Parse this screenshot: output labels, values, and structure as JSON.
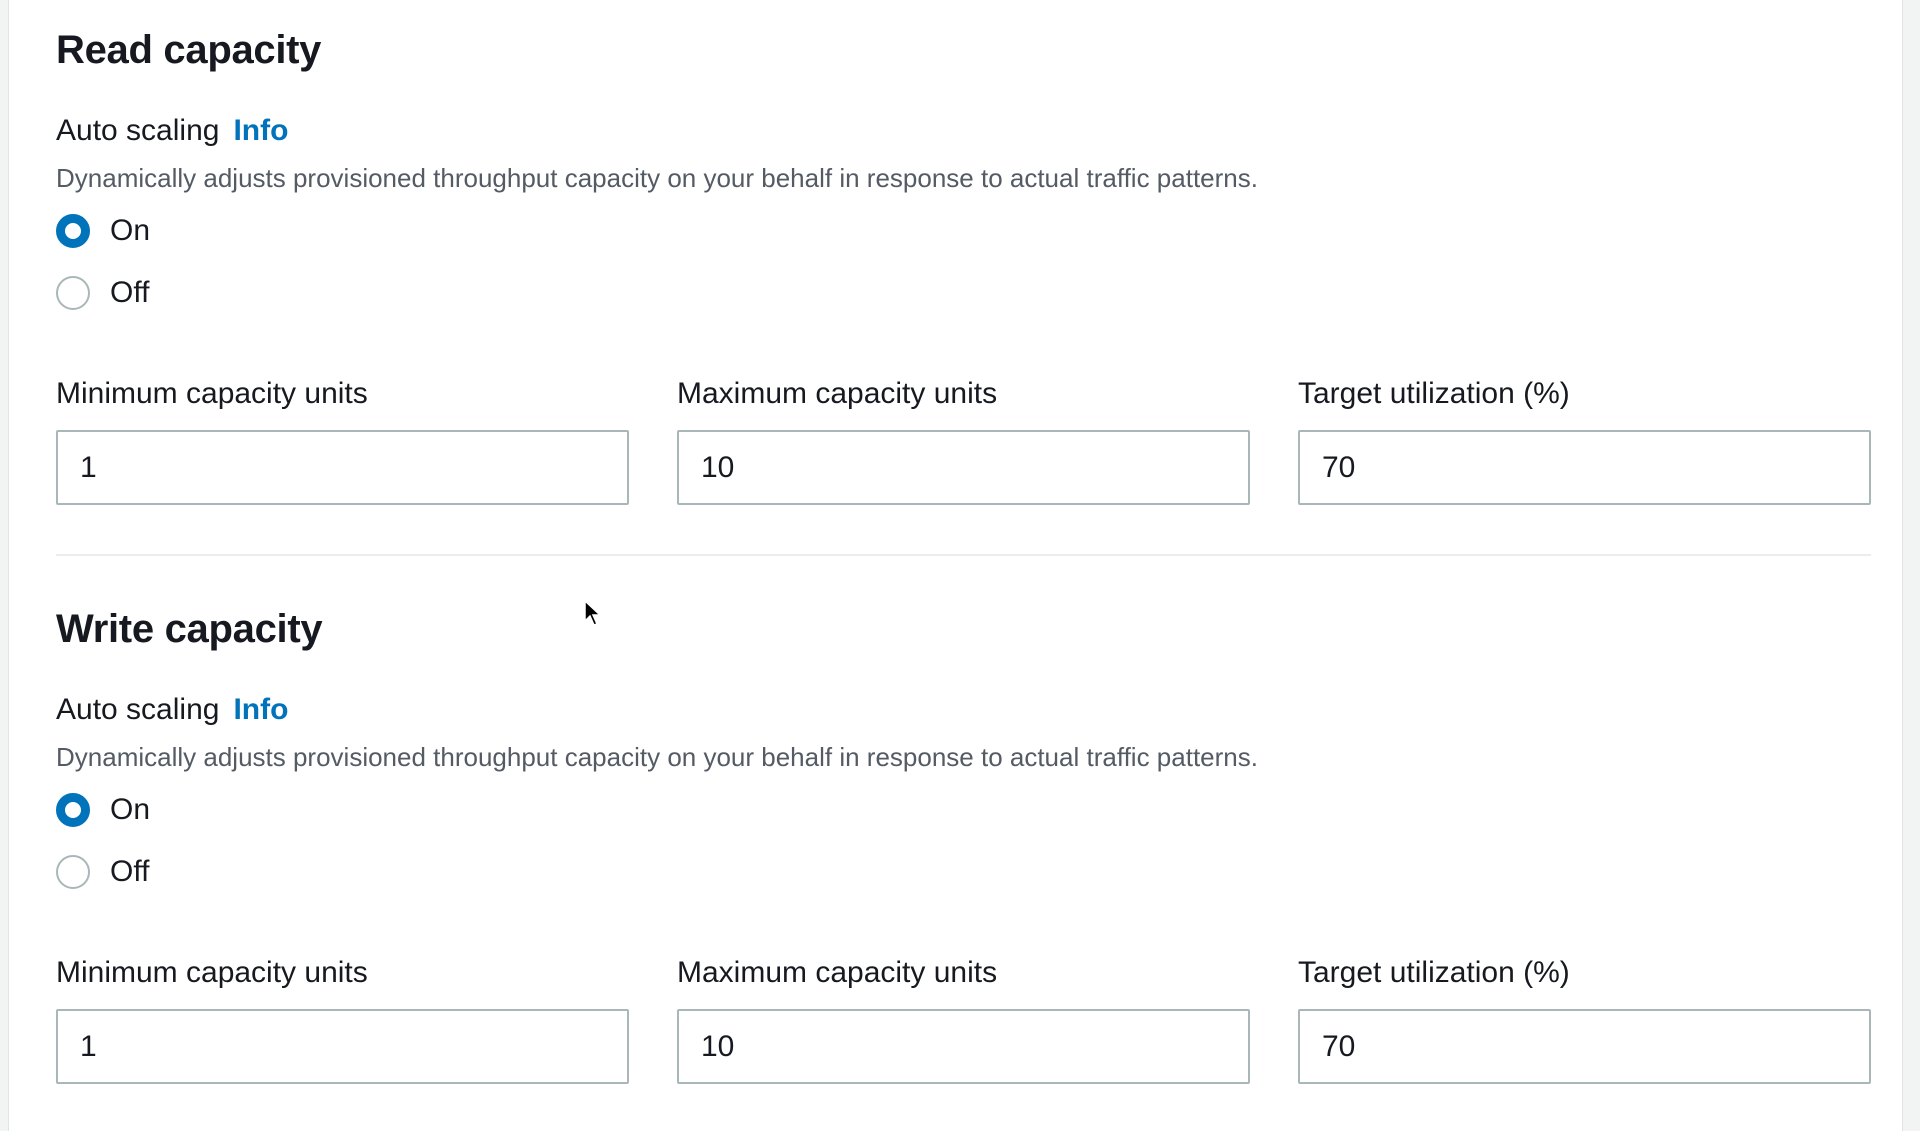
{
  "read": {
    "title": "Read capacity",
    "auto_scaling_label": "Auto scaling",
    "info_link": "Info",
    "description": "Dynamically adjusts provisioned throughput capacity on your behalf in response to actual traffic patterns.",
    "options": [
      {
        "label": "On",
        "checked": true
      },
      {
        "label": "Off",
        "checked": false
      }
    ],
    "fields": [
      {
        "label": "Minimum capacity units",
        "value": "1"
      },
      {
        "label": "Maximum capacity units",
        "value": "10"
      },
      {
        "label": "Target utilization (%)",
        "value": "70"
      }
    ]
  },
  "write": {
    "title": "Write capacity",
    "auto_scaling_label": "Auto scaling",
    "info_link": "Info",
    "description": "Dynamically adjusts provisioned throughput capacity on your behalf in response to actual traffic patterns.",
    "options": [
      {
        "label": "On",
        "checked": true
      },
      {
        "label": "Off",
        "checked": false
      }
    ],
    "fields": [
      {
        "label": "Minimum capacity units",
        "value": "1"
      },
      {
        "label": "Maximum capacity units",
        "value": "10"
      },
      {
        "label": "Target utilization (%)",
        "value": "70"
      }
    ]
  },
  "colors": {
    "accent": "#0073bb",
    "text": "#16191f",
    "secondary_text": "#545b64",
    "border": "#aab7b8"
  }
}
